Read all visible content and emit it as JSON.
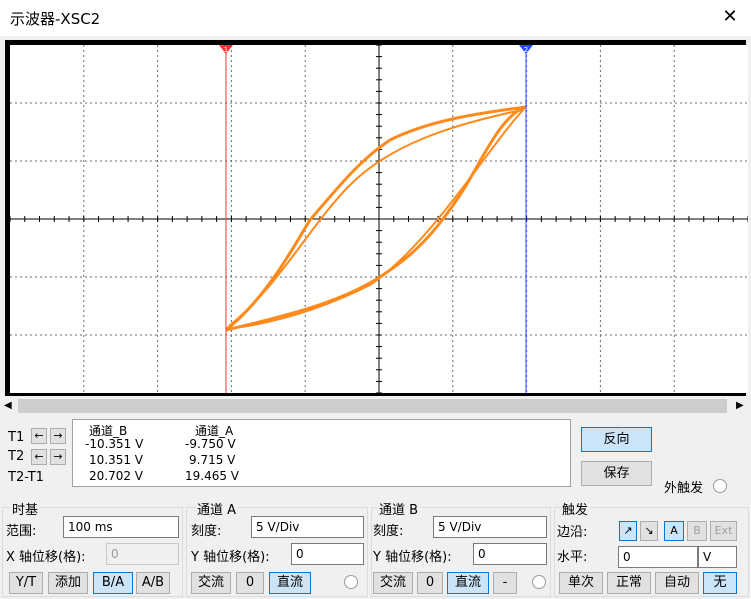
{
  "window": {
    "title": "示波器-XSC2",
    "close_glyph": "✕"
  },
  "colors": {
    "screen_bg": "#000000",
    "grid": "#6a6a6a",
    "axis": "#ffffff",
    "trace": "#ff8a1c",
    "cursor1": "#ff3030",
    "cursor2": "#2a4dff"
  },
  "cursors": {
    "t1_marker": "1",
    "t2_marker": "2"
  },
  "readout": {
    "header": {
      "ch_b": "通道_B",
      "ch_a": "通道_A"
    },
    "rows": [
      {
        "label": "T1",
        "b": "-10.351 V",
        "a": "-9.750 V"
      },
      {
        "label": "T2",
        "b": "10.351 V",
        "a": "9.715 V"
      },
      {
        "label": "T2-T1",
        "b": "20.702 V",
        "a": "19.465 V"
      }
    ]
  },
  "buttons": {
    "reverse": "反向",
    "save": "保存",
    "ext_trigger": "外触发"
  },
  "timebase": {
    "title": "时基",
    "range_label": "范围:",
    "range_value": "100 ms",
    "xpos_label": "X 轴位移(格):",
    "xpos_value": "0",
    "modes": [
      "Y/T",
      "添加",
      "B/A",
      "A/B"
    ],
    "selected_mode": "B/A"
  },
  "channel_a": {
    "title": "通道 A",
    "scale_label": "刻度:",
    "scale_value": "5  V/Div",
    "ypos_label": "Y 轴位移(格):",
    "ypos_value": "0",
    "coupling": [
      "交流",
      "0",
      "直流"
    ],
    "selected": "直流"
  },
  "channel_b": {
    "title": "通道 B",
    "scale_label": "刻度:",
    "scale_value": "5  V/Div",
    "ypos_label": "Y 轴位移(格):",
    "ypos_value": "0",
    "coupling": [
      "交流",
      "0",
      "直流",
      "-"
    ],
    "selected": "直流"
  },
  "trigger": {
    "title": "触发",
    "edge_label": "边沿:",
    "edge_glyphs": [
      "↗",
      "↘"
    ],
    "sources": [
      "A",
      "B",
      "Ext"
    ],
    "level_label": "水平:",
    "level_value": "0",
    "level_unit": "V",
    "modes": [
      "单次",
      "正常",
      "自动",
      "无"
    ],
    "selected_mode": "无"
  }
}
